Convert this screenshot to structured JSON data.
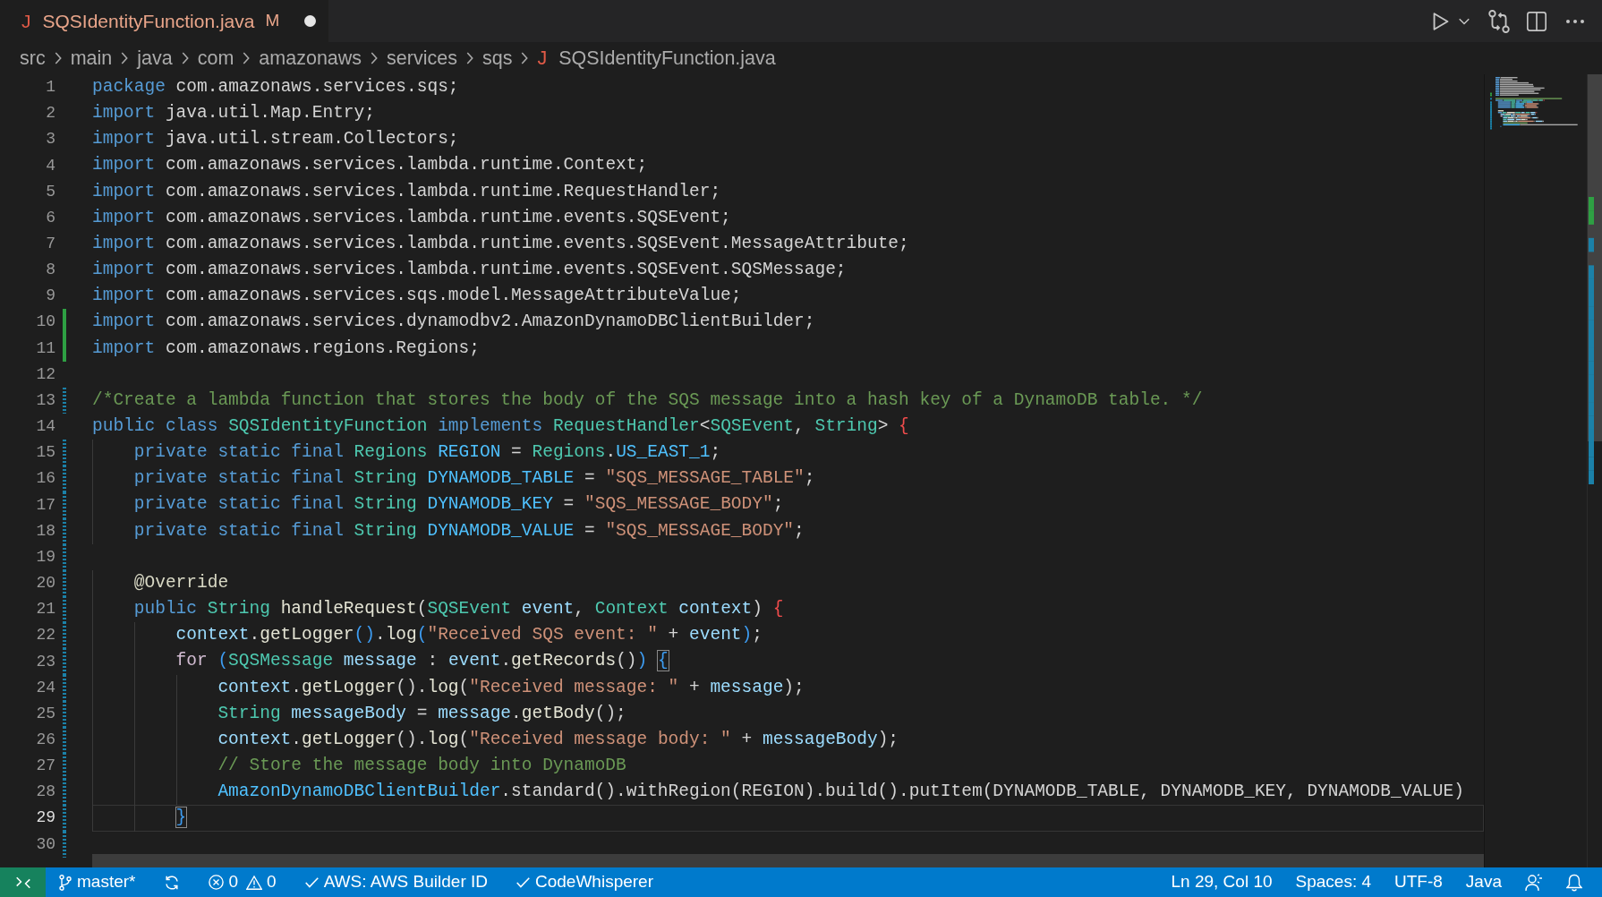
{
  "tabs": [
    {
      "file_icon": "J",
      "label": "SQSIdentityFunction.java",
      "git_status": "M",
      "selected": true,
      "unsaved": true
    }
  ],
  "breadcrumbs": [
    {
      "label": "src"
    },
    {
      "label": "main"
    },
    {
      "label": "java"
    },
    {
      "label": "com"
    },
    {
      "label": "amazonaws"
    },
    {
      "label": "services"
    },
    {
      "label": "sqs"
    },
    {
      "label": "SQSIdentityFunction.java",
      "file_icon": "J"
    }
  ],
  "editor": {
    "lines": [
      {
        "number": "1",
        "added": false,
        "modified": false,
        "current": false,
        "tokens": [
          {
            "kind": "keyword",
            "text": "package"
          },
          {
            "kind": "plain",
            "text": " com.amazonaws.services.sqs;"
          }
        ]
      },
      {
        "number": "2",
        "added": false,
        "modified": false,
        "current": false,
        "tokens": [
          {
            "kind": "keyword",
            "text": "import"
          },
          {
            "kind": "plain",
            "text": " java.util.Map.Entry;"
          }
        ]
      },
      {
        "number": "3",
        "added": false,
        "modified": false,
        "current": false,
        "tokens": [
          {
            "kind": "keyword",
            "text": "import"
          },
          {
            "kind": "plain",
            "text": " java.util.stream.Collectors;"
          }
        ]
      },
      {
        "number": "4",
        "added": false,
        "modified": false,
        "current": false,
        "tokens": [
          {
            "kind": "keyword",
            "text": "import"
          },
          {
            "kind": "plain",
            "text": " com.amazonaws.services.lambda.runtime.Context;"
          }
        ]
      },
      {
        "number": "5",
        "added": false,
        "modified": false,
        "current": false,
        "tokens": [
          {
            "kind": "keyword",
            "text": "import"
          },
          {
            "kind": "plain",
            "text": " com.amazonaws.services.lambda.runtime.RequestHandler;"
          }
        ]
      },
      {
        "number": "6",
        "added": false,
        "modified": false,
        "current": false,
        "tokens": [
          {
            "kind": "keyword",
            "text": "import"
          },
          {
            "kind": "plain",
            "text": " com.amazonaws.services.lambda.runtime.events.SQSEvent;"
          }
        ]
      },
      {
        "number": "7",
        "added": false,
        "modified": false,
        "current": false,
        "tokens": [
          {
            "kind": "keyword",
            "text": "import"
          },
          {
            "kind": "plain",
            "text": " com.amazonaws.services.lambda.runtime.events.SQSEvent.MessageAttribute;"
          }
        ]
      },
      {
        "number": "8",
        "added": false,
        "modified": false,
        "current": false,
        "tokens": [
          {
            "kind": "keyword",
            "text": "import"
          },
          {
            "kind": "plain",
            "text": " com.amazonaws.services.lambda.runtime.events.SQSEvent.SQSMessage;"
          }
        ]
      },
      {
        "number": "9",
        "added": false,
        "modified": false,
        "current": false,
        "tokens": [
          {
            "kind": "keyword",
            "text": "import"
          },
          {
            "kind": "plain",
            "text": " com.amazonaws.services.sqs.model.MessageAttributeValue;"
          }
        ]
      },
      {
        "number": "10",
        "added": true,
        "modified": false,
        "current": false,
        "tokens": [
          {
            "kind": "keyword",
            "text": "import"
          },
          {
            "kind": "plain",
            "text": " com.amazonaws.services.dynamodbv2.AmazonDynamoDBClientBuilder;"
          }
        ]
      },
      {
        "number": "11",
        "added": true,
        "modified": false,
        "current": false,
        "tokens": [
          {
            "kind": "keyword",
            "text": "import"
          },
          {
            "kind": "plain",
            "text": " com.amazonaws.regions.Regions;"
          }
        ]
      },
      {
        "number": "12",
        "added": false,
        "modified": false,
        "current": false
      },
      {
        "number": "13",
        "added": false,
        "modified": true,
        "current": false,
        "tokens": [
          {
            "kind": "comment",
            "text": "/*Create a lambda function that stores the body of the SQS message into a hash key of a DynamoDB table. */"
          }
        ]
      },
      {
        "number": "14",
        "added": false,
        "modified": false,
        "current": false,
        "tokens": [
          {
            "kind": "keyword",
            "text": "public class "
          },
          {
            "kind": "type",
            "text": "SQSIdentityFunction "
          },
          {
            "kind": "keyword",
            "text": "implements "
          },
          {
            "kind": "type",
            "text": "RequestHandler"
          },
          {
            "kind": "plain",
            "text": "<"
          },
          {
            "kind": "type",
            "text": "SQSEvent"
          },
          {
            "kind": "plain",
            "text": ", "
          },
          {
            "kind": "type",
            "text": "String"
          },
          {
            "kind": "plain",
            "text": "> "
          },
          {
            "kind": "unmatched",
            "text": "{"
          }
        ]
      },
      {
        "number": "15",
        "added": false,
        "modified": true,
        "current": false,
        "tokens": [
          {
            "kind": "keyword",
            "text": "    private static final "
          },
          {
            "kind": "type",
            "text": "Regions "
          },
          {
            "kind": "constant",
            "text": "REGION"
          },
          {
            "kind": "plain",
            "text": " = "
          },
          {
            "kind": "type",
            "text": "Regions"
          },
          {
            "kind": "plain",
            "text": "."
          },
          {
            "kind": "constant",
            "text": "US_EAST_1"
          },
          {
            "kind": "plain",
            "text": ";"
          }
        ]
      },
      {
        "number": "16",
        "added": false,
        "modified": true,
        "current": false,
        "tokens": [
          {
            "kind": "keyword",
            "text": "    private static final "
          },
          {
            "kind": "type",
            "text": "String "
          },
          {
            "kind": "constant",
            "text": "DYNAMODB_TABLE"
          },
          {
            "kind": "plain",
            "text": " = "
          },
          {
            "kind": "string",
            "text": "\"SQS_MESSAGE_TABLE\""
          },
          {
            "kind": "plain",
            "text": ";"
          }
        ]
      },
      {
        "number": "17",
        "added": false,
        "modified": true,
        "current": false,
        "tokens": [
          {
            "kind": "keyword",
            "text": "    private static final "
          },
          {
            "kind": "type",
            "text": "String "
          },
          {
            "kind": "constant",
            "text": "DYNAMODB_KEY"
          },
          {
            "kind": "plain",
            "text": " = "
          },
          {
            "kind": "string",
            "text": "\"SQS_MESSAGE_BODY\""
          },
          {
            "kind": "plain",
            "text": ";"
          }
        ]
      },
      {
        "number": "18",
        "added": false,
        "modified": true,
        "current": false,
        "tokens": [
          {
            "kind": "keyword",
            "text": "    private static final "
          },
          {
            "kind": "type",
            "text": "String "
          },
          {
            "kind": "constant",
            "text": "DYNAMODB_VALUE"
          },
          {
            "kind": "plain",
            "text": " = "
          },
          {
            "kind": "string",
            "text": "\"SQS_MESSAGE_BODY\""
          },
          {
            "kind": "plain",
            "text": ";"
          }
        ]
      },
      {
        "number": "19",
        "added": false,
        "modified": true,
        "current": false
      },
      {
        "number": "20",
        "added": false,
        "modified": true,
        "current": false,
        "tokens": [
          {
            "kind": "annotation",
            "text": "    @Override"
          }
        ]
      },
      {
        "number": "21",
        "added": false,
        "modified": true,
        "current": false,
        "tokens": [
          {
            "kind": "keyword",
            "text": "    public "
          },
          {
            "kind": "type",
            "text": "String "
          },
          {
            "kind": "function",
            "text": "handleRequest"
          },
          {
            "kind": "plain",
            "text": "("
          },
          {
            "kind": "type",
            "text": "SQSEvent "
          },
          {
            "kind": "variable",
            "text": "event"
          },
          {
            "kind": "plain",
            "text": ", "
          },
          {
            "kind": "type",
            "text": "Context "
          },
          {
            "kind": "variable",
            "text": "context"
          },
          {
            "kind": "plain",
            "text": ") "
          },
          {
            "kind": "unmatched",
            "text": "{"
          }
        ]
      },
      {
        "number": "22",
        "added": false,
        "modified": true,
        "current": false,
        "tokens": [
          {
            "kind": "variable",
            "text": "        context"
          },
          {
            "kind": "plain",
            "text": "."
          },
          {
            "kind": "function",
            "text": "getLogger"
          },
          {
            "kind": "bracket",
            "text": "()"
          },
          {
            "kind": "plain",
            "text": "."
          },
          {
            "kind": "function",
            "text": "log"
          },
          {
            "kind": "bracket",
            "text": "("
          },
          {
            "kind": "string",
            "text": "\"Received SQS event: \""
          },
          {
            "kind": "plain",
            "text": " + "
          },
          {
            "kind": "variable",
            "text": "event"
          },
          {
            "kind": "bracket",
            "text": ")"
          },
          {
            "kind": "plain",
            "text": ";"
          }
        ]
      },
      {
        "number": "23",
        "added": false,
        "modified": true,
        "current": false,
        "tokens": [
          {
            "kind": "control",
            "text": "        for "
          },
          {
            "kind": "bracket",
            "text": "("
          },
          {
            "kind": "type",
            "text": "SQSMessage "
          },
          {
            "kind": "variable",
            "text": "message"
          },
          {
            "kind": "plain",
            "text": " : "
          },
          {
            "kind": "variable",
            "text": "event"
          },
          {
            "kind": "plain",
            "text": "."
          },
          {
            "kind": "function",
            "text": "getRecords"
          },
          {
            "kind": "plain",
            "text": "()"
          },
          {
            "kind": "bracket",
            "text": ") "
          },
          {
            "kind": "matched",
            "text": "{"
          }
        ]
      },
      {
        "number": "24",
        "added": false,
        "modified": true,
        "current": false,
        "tokens": [
          {
            "kind": "variable",
            "text": "            context"
          },
          {
            "kind": "plain",
            "text": "."
          },
          {
            "kind": "function",
            "text": "getLogger"
          },
          {
            "kind": "plain",
            "text": "()."
          },
          {
            "kind": "function",
            "text": "log"
          },
          {
            "kind": "plain",
            "text": "("
          },
          {
            "kind": "string",
            "text": "\"Received message: \""
          },
          {
            "kind": "plain",
            "text": " + "
          },
          {
            "kind": "variable",
            "text": "message"
          },
          {
            "kind": "plain",
            "text": ");"
          }
        ]
      },
      {
        "number": "25",
        "added": false,
        "modified": true,
        "current": false,
        "tokens": [
          {
            "kind": "type",
            "text": "            String "
          },
          {
            "kind": "variable",
            "text": "messageBody"
          },
          {
            "kind": "plain",
            "text": " = "
          },
          {
            "kind": "variable",
            "text": "message"
          },
          {
            "kind": "plain",
            "text": "."
          },
          {
            "kind": "function",
            "text": "getBody"
          },
          {
            "kind": "plain",
            "text": "();"
          }
        ]
      },
      {
        "number": "26",
        "added": false,
        "modified": true,
        "current": false,
        "tokens": [
          {
            "kind": "variable",
            "text": "            context"
          },
          {
            "kind": "plain",
            "text": "."
          },
          {
            "kind": "function",
            "text": "getLogger"
          },
          {
            "kind": "plain",
            "text": "()."
          },
          {
            "kind": "function",
            "text": "log"
          },
          {
            "kind": "plain",
            "text": "("
          },
          {
            "kind": "string",
            "text": "\"Received message body: \""
          },
          {
            "kind": "plain",
            "text": " + "
          },
          {
            "kind": "variable",
            "text": "messageBody"
          },
          {
            "kind": "plain",
            "text": ");"
          }
        ]
      },
      {
        "number": "27",
        "added": false,
        "modified": true,
        "current": false,
        "tokens": [
          {
            "kind": "comment",
            "text": "            // Store the message body into DynamoDB"
          }
        ]
      },
      {
        "number": "28",
        "added": false,
        "modified": true,
        "current": false,
        "tokens": [
          {
            "kind": "constant",
            "text": "            AmazonDynamoDBClientBuilder"
          },
          {
            "kind": "plain",
            "text": ".standard().withRegion(REGION).build().putItem(DYNAMODB_TABLE, DYNAMODB_KEY, DYNAMODB_VALUE)"
          }
        ]
      },
      {
        "number": "29",
        "added": false,
        "modified": true,
        "current": true,
        "tokens": [
          {
            "kind": "matched",
            "text": "        }"
          }
        ]
      },
      {
        "number": "30",
        "added": false,
        "modified": true,
        "current": false
      }
    ]
  },
  "status_bar": {
    "left": [
      {
        "kind": "remote"
      },
      {
        "kind": "branch",
        "label": "master*"
      },
      {
        "kind": "sync"
      },
      {
        "kind": "problems",
        "errors": "0",
        "warnings": "0"
      },
      {
        "kind": "check",
        "label": "AWS: AWS Builder ID"
      },
      {
        "kind": "check",
        "label": "CodeWhisperer"
      }
    ],
    "right": [
      {
        "kind": "text",
        "label": "Ln 29, Col 10"
      },
      {
        "kind": "text",
        "label": "Spaces: 4"
      },
      {
        "kind": "text",
        "label": "UTF-8"
      },
      {
        "kind": "text",
        "label": "Java"
      },
      {
        "kind": "feedback"
      },
      {
        "kind": "bell"
      }
    ]
  }
}
